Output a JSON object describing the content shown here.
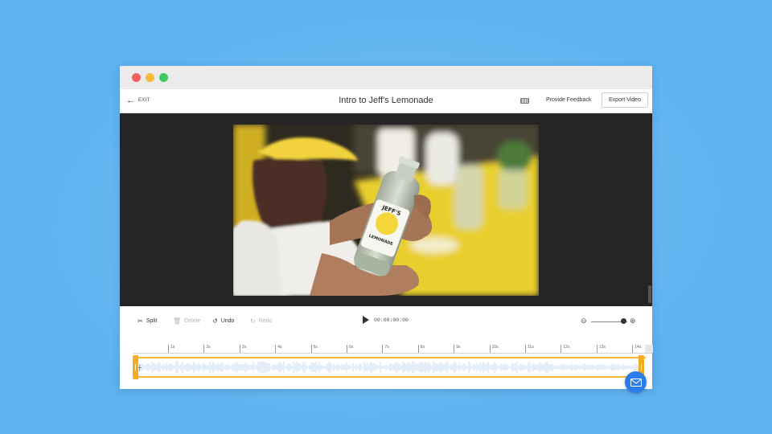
{
  "header": {
    "exit_label": "EXIT",
    "title": "Intro to Jeff's Lemonade",
    "feedback_label": "Provide Feedback",
    "export_label": "Export Video"
  },
  "toolbar": {
    "split_label": "Split",
    "delete_label": "Delete",
    "undo_label": "Undo",
    "redo_label": "Redo",
    "timecode": "00:00:00:00"
  },
  "video": {
    "bottle_brand": "JEFF'S",
    "bottle_product": "LEMONADE"
  },
  "timeline": {
    "ticks": [
      "1s",
      "2s",
      "3s",
      "4s",
      "5s",
      "6s",
      "7s",
      "8s",
      "9s",
      "10s",
      "11s",
      "12s",
      "13s",
      "14s"
    ]
  },
  "icons": {
    "exit": "arrow-left-icon",
    "keyboard": "keyboard-icon",
    "split": "scissors-icon",
    "delete": "trash-icon",
    "undo": "undo-icon",
    "redo": "redo-icon",
    "play": "play-icon",
    "zoom_out": "zoom-out-icon",
    "zoom_in": "zoom-in-icon",
    "chat": "mail-icon"
  },
  "colors": {
    "background": "#5eb2ef",
    "accent_clip": "#f7b733",
    "fab": "#2b7de9",
    "player_bg": "#252525"
  }
}
